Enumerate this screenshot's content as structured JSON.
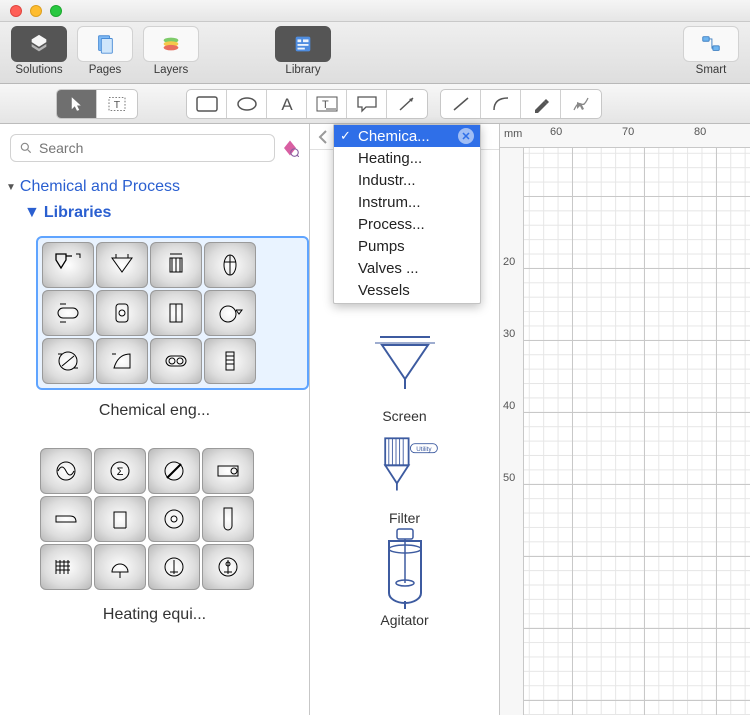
{
  "window_controls": [
    "close",
    "minimize",
    "maximize"
  ],
  "toolbar": {
    "solutions": "Solutions",
    "pages": "Pages",
    "layers": "Layers",
    "library": "Library",
    "smart": "Smart"
  },
  "search": {
    "placeholder": "Search"
  },
  "tree": {
    "root": "Chemical and Process",
    "libraries": "Libraries",
    "groups": [
      {
        "caption": "Chemical eng...",
        "selected": true
      },
      {
        "caption": "Heating equi...",
        "selected": false
      }
    ]
  },
  "dropdown": {
    "items": [
      {
        "label": "Chemica...",
        "selected": true
      },
      {
        "label": "Heating..."
      },
      {
        "label": "Industr..."
      },
      {
        "label": "Instrum..."
      },
      {
        "label": "Process..."
      },
      {
        "label": "Pumps"
      },
      {
        "label": "Valves ..."
      },
      {
        "label": "Vessels"
      }
    ]
  },
  "shapes_panel": {
    "items": [
      {
        "name": "Screen"
      },
      {
        "name": "Filter",
        "badge": "Utility"
      },
      {
        "name": "Agitator"
      }
    ]
  },
  "ruler": {
    "unit": "mm",
    "h_marks": [
      "60",
      "70",
      "80"
    ],
    "v_marks": [
      "20",
      "30",
      "40",
      "50"
    ]
  }
}
